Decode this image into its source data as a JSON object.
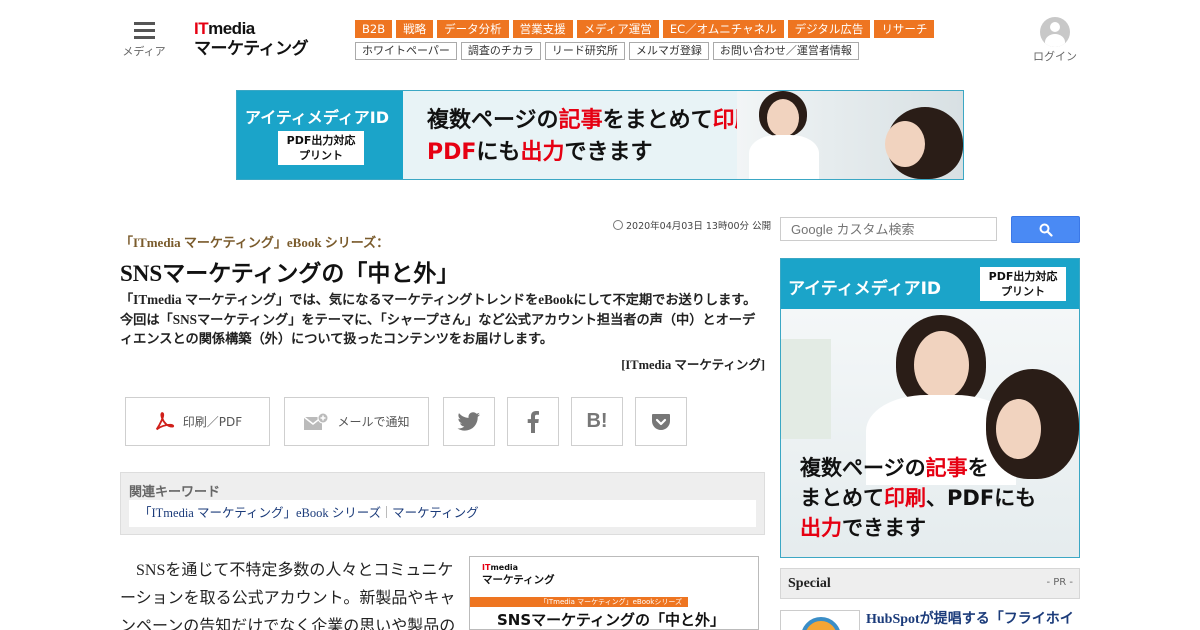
{
  "header": {
    "menu_label": "メディア",
    "logo_line1_a": "IT",
    "logo_line1_b": "media",
    "logo_line2": "マーケティング",
    "categories": [
      "B2B",
      "戦略",
      "データ分析",
      "営業支援",
      "メディア運営",
      "EC／オムニチャネル",
      "デジタル広告",
      "リサーチ"
    ],
    "subnav": [
      "ホワイトペーパー",
      "調査のチカラ",
      "リード研究所",
      "メルマガ登録",
      "お問い合わせ／運営者情報"
    ],
    "login_label": "ログイン"
  },
  "top_banner": {
    "brand": "アイティメディアID",
    "pdf_line1": "PDF出力対応",
    "pdf_line2": "プリント",
    "copy_1a": "複数ページの",
    "copy_1b": "記事",
    "copy_1c": "をまとめて",
    "copy_1d": "印刷",
    "copy_1e": "、",
    "copy_2a": "PDF",
    "copy_2b": "にも",
    "copy_2c": "出力",
    "copy_2d": "できます"
  },
  "article": {
    "pubdate": "2020年04月03日 13時00分 公開",
    "series": "「ITmedia マーケティング」eBook シリーズ：",
    "title": "SNSマーケティングの「中と外」",
    "lead": "「ITmedia マーケティング」では、気になるマーケティングトレンドをeBookにして不定期でお送りします。今回は「SNSマーケティング」をテーマに、「シャープさん」など公式アカウント担当者の声（中）とオーディエンスとの関係構築（外）について扱ったコンテンツをお届けします。",
    "byline": "[ITmedia マーケティング]",
    "body": "SNSを通じて不特定多数の人々とコミュニケーションを取る公式アカウント。新製品やキャンペーンの告知だけでなく企業の思いや製品の"
  },
  "share": {
    "print_label": "印刷／PDF",
    "mail_label": "メールで通知",
    "hatena_label": "B!"
  },
  "keywords": {
    "title": "関連キーワード",
    "items": [
      "「ITmedia マーケティング」eBook シリーズ",
      "マーケティング"
    ]
  },
  "ebook": {
    "logo_a": "IT",
    "logo_b": "media",
    "logo_line2": "マーケティング",
    "strip": "「ITmedia マーケティング」eBookシリーズ",
    "title": "SNSマーケティングの「中と外」"
  },
  "sidebar": {
    "search_placeholder": "Google カスタム検索",
    "banner_brand": "アイティメディアID",
    "banner_pdf_line1": "PDF出力対応",
    "banner_pdf_line2": "プリント",
    "banner_copy_1a": "複数ページの",
    "banner_copy_1b": "記事",
    "banner_copy_1c": "を",
    "banner_copy_2a": "まとめて",
    "banner_copy_2b": "印刷",
    "banner_copy_2c": "、PDFにも",
    "banner_copy_3a": "出力",
    "banner_copy_3b": "できます",
    "special_title": "Special",
    "special_pr": "- PR -",
    "hs_title": "HubSpotが提唱する「フライホイ"
  },
  "colors": {
    "accent_orange": "#ee7521",
    "brand_red": "#e60012",
    "banner_cyan": "#1ba4c9",
    "search_blue": "#4a8af4",
    "link_navy": "#1b3b7a"
  }
}
